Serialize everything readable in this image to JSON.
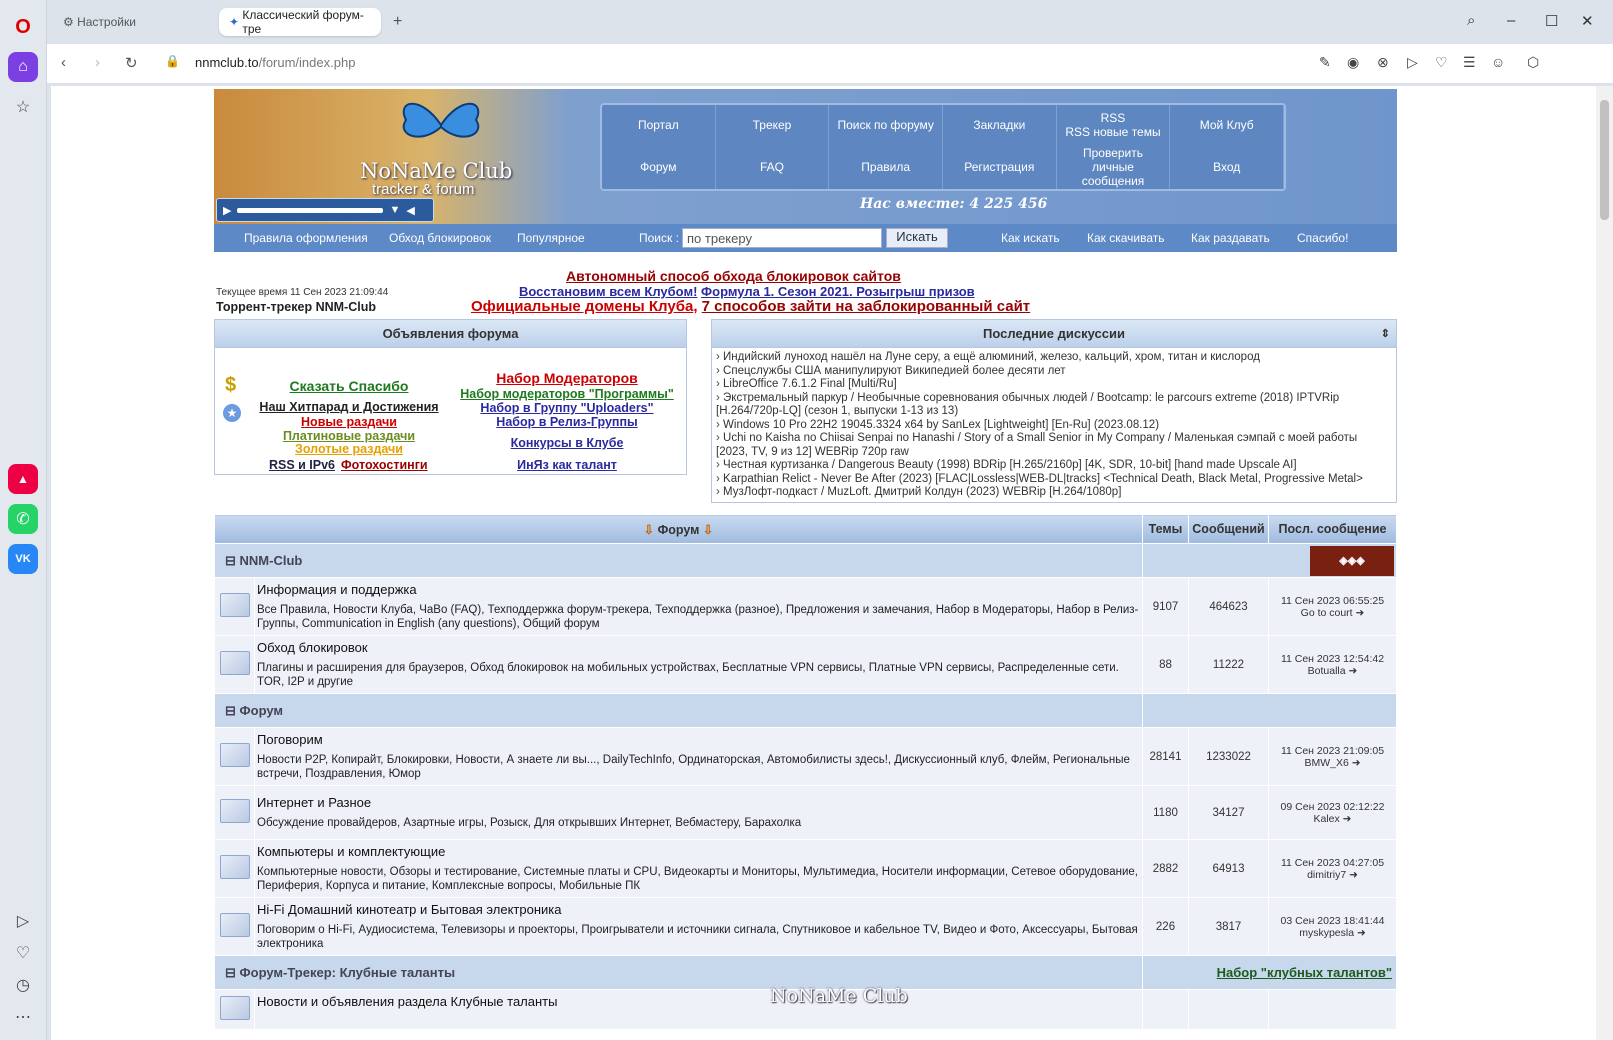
{
  "browser": {
    "tabs": [
      {
        "label": "Настройки"
      },
      {
        "label": "Классический форум-тре"
      }
    ],
    "url_host": "nnmclub.to",
    "url_path": "/forum/index.php"
  },
  "header": {
    "logo_title": "NoNaMe Club",
    "logo_sub": "tracker & forum",
    "menu": [
      "Портал",
      "Трекер",
      "Поиск по форуму",
      "Закладки",
      "RSS\nRSS новые темы",
      "Мой Клуб",
      "Форум",
      "FAQ",
      "Правила",
      "Регистрация",
      "Проверить личные сообщения",
      "Вход"
    ],
    "total": "Нас вместе: 4 225 456"
  },
  "subnav": {
    "items": [
      "Правила оформления",
      "Обход блокировок",
      "Популярное"
    ],
    "search_label": "Поиск :",
    "search_placeholder": "по трекеру",
    "search_button": "Искать",
    "right": [
      "Как искать",
      "Как скачивать",
      "Как раздавать",
      "Спасибо!"
    ]
  },
  "notices": {
    "line1": "Автономный способ обхода блокировок сайтов",
    "line2a": "Восстановим всем Клубом!",
    "line2b": "Формула 1. Сезон 2021. Розыгрыш призов",
    "line3a": "Официальные домены Клуба",
    "line3b": "7 способов зайти на заблокированный сайт",
    "current_time": "Текущее время 11 Сен 2023 21:09:44",
    "tracker_label": "Торрент-трекер NNM-Club"
  },
  "announcements": {
    "title": "Объявления форума",
    "left": [
      "Сказать Спасибо",
      "Наш Хитпарад и Достижения",
      "Новые раздачи",
      "Платиновые раздачи",
      "Золотые раздачи",
      "RSS и IPv6",
      "Фотохостинги"
    ],
    "right": [
      "Набор Модераторов",
      "Набор модераторов \"Программы\"",
      "Набор в Группу \"Uploaders\"",
      "Набор в Релиз-Группы",
      "Конкурсы в Клубе",
      "ИнЯз как талант"
    ]
  },
  "discussions": {
    "title": "Последние дискуссии",
    "items": [
      "Индийский луноход нашёл на Луне серу, а ещё алюминий, железо, кальций, хром, титан и кислород",
      "Спецслужбы США манипулируют Википедией более десяти лет",
      "LibreOffice 7.6.1.2 Final [Multi/Ru]",
      "Экстремальный паркур / Необычные соревнования обычных людей / Bootcamp: le parcours extreme (2018) IPTVRip [H.264/720p-LQ] (сезон 1, выпуски 1-13 из 13)",
      "Windows 10 Pro 22H2 19045.3324 x64 by SanLex [Lightweight] [En-Ru] (2023.08.12)",
      "Uchi no Kaisha no Chiisai Senpai no Hanashi / Story of a Small Senior in My Company / Маленькая сэмпай с моей работы [2023, TV, 9 из 12] WEBRip 720p raw",
      "Честная куртизанка / Dangerous Beauty (1998) BDRip [H.265/2160p] [4K, SDR, 10-bit] [hand made Upscale AI]",
      "Karpathian Relict - Never Be After (2023) [FLAC|Lossless|WEB-DL|tracks] <Technical Death, Black Metal, Progressive Metal>",
      "МузЛофт-подкаст / MuzLoft. Дмитрий Колдун (2023) WEBRip [H.264/1080p]"
    ]
  },
  "forum": {
    "cols": {
      "forum": "Форум",
      "topics": "Темы",
      "posts": "Сообщений",
      "last": "Посл. сообщение"
    },
    "cat1": "NNM-Club",
    "cat2": "Форум",
    "cat3": "Форум-Трекер: Клубные таланты",
    "cat3_link": "Набор \"клубных талантов\"",
    "rows": [
      {
        "title": "Информация и поддержка",
        "subs": "Все Правила, Новости Клуба, ЧаВо (FAQ), Техподдержка форум-трекера, Техподдержка (разное), Предложения и замечания, Набор в Модераторы, Набор в Релиз-Группы, Communication in English (any questions), Общий форум",
        "topics": "9107",
        "posts": "464623",
        "date": "11 Сен 2023 06:55:25",
        "user": "Go to court"
      },
      {
        "title": "Обход блокировок",
        "subs": "Плагины и расширения для браузеров, Обход блокировок на мобильных устройствах, Бесплатные VPN сервисы, Платные VPN сервисы, Распределенные сети. TOR, I2P и другие",
        "topics": "88",
        "posts": "11222",
        "date": "11 Сен 2023 12:54:42",
        "user": "Botualla"
      },
      {
        "title": "Поговорим",
        "subs": "Новости P2P, Копирайт, Блокировки, Новости, А знаете ли вы..., DailyTechInfo, Ординаторская, Автомобилисты здесь!, Дискуссионный клуб, Флейм, Региональные встречи, Поздравления, Юмор",
        "topics": "28141",
        "posts": "1233022",
        "date": "11 Сен 2023 21:09:05",
        "user": "BMW_X6"
      },
      {
        "title": "Интернет и Разное",
        "subs": "Обсуждение провайдеров, Азартные игры, Розыск, Для открывших Интернет, Вебмастеру, Барахолка",
        "topics": "1180",
        "posts": "34127",
        "date": "09 Сен 2023 02:12:22",
        "user": "Kalex"
      },
      {
        "title": "Компьютеры и комплектующие",
        "subs": "Компьютерные новости, Обзоры и тестирование, Системные платы и CPU, Видеокарты и Мониторы, Мультимедиа, Носители информации, Сетевое оборудование, Периферия, Корпуса и питание, Комплексные вопросы, Мобильные ПК",
        "topics": "2882",
        "posts": "64913",
        "date": "11 Сен 2023 04:27:05",
        "user": "dimitriy7"
      },
      {
        "title": "Hi-Fi Домашний кинотеатр и Бытовая электроника",
        "subs": "Поговорим о Hi-Fi, Аудиосистема, Телевизоры и проекторы, Проигрыватели и источники сигнала, Спутниковое и кабельное TV, Видео и Фото, Аксессуары, Бытовая электроника",
        "topics": "226",
        "posts": "3817",
        "date": "03 Сен 2023 18:41:44",
        "user": "myskypesla"
      },
      {
        "title": "Новости и объявления раздела Клубные таланты"
      }
    ]
  },
  "watermark": "NoNaMe Club"
}
